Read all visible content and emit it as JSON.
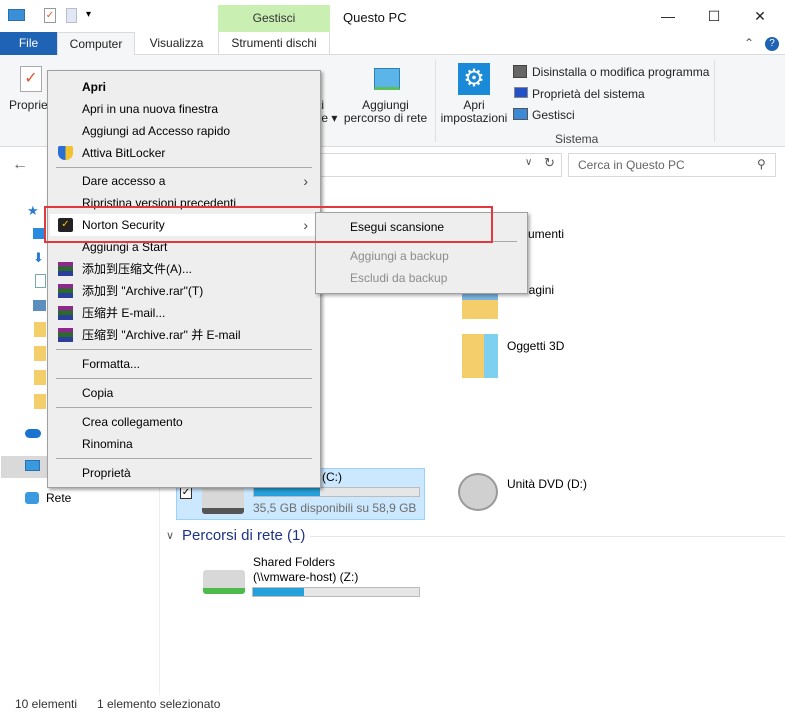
{
  "window": {
    "title": "Questo PC",
    "contextual_tab_group": "Gestisci",
    "minimize": "—",
    "maximize": "☐",
    "close": "✕"
  },
  "ribbon": {
    "tabs": [
      {
        "label": "File"
      },
      {
        "label": "Computer",
        "selected": true
      },
      {
        "label": "Visualizza"
      },
      {
        "label": "Strumenti dischi"
      }
    ],
    "buttons": {
      "properties": "Proprie",
      "map_drive_line1": "ti",
      "map_drive_line2": "te",
      "add_network_line1": "Aggiungi",
      "add_network_line2": "percorso di rete",
      "open_settings_line1": "Apri",
      "open_settings_line2": "impostazioni",
      "uninstall": "Disinstalla o modifica programma",
      "system_properties": "Proprietà del sistema",
      "manage": "Gestisci"
    },
    "group_system": "Sistema"
  },
  "addressbar": {
    "search_placeholder": "Cerca in Questo PC"
  },
  "sidebar": {
    "network": "Rete"
  },
  "content": {
    "folders": [
      {
        "name": "umenti"
      },
      {
        "name": "nagini"
      },
      {
        "name": "Oggetti 3D"
      }
    ],
    "drives": [
      {
        "name": "(C:)",
        "free": "35,5 GB disponibili su 58,9 GB",
        "used_percent": 40,
        "selected": true
      },
      {
        "name": "Unità DVD (D:)"
      }
    ],
    "network_header": "Percorsi di rete (1)",
    "network_locations": [
      {
        "name_line1": "Shared Folders",
        "name_line2": "(\\\\vmware-host) (Z:)",
        "used_percent": 31
      }
    ]
  },
  "context_menu": {
    "items": [
      "Apri",
      "Apri in una nuova finestra",
      "Aggiungi ad Accesso rapido",
      "Attiva BitLocker",
      "Dare accesso a",
      "Ripristina versioni precedenti",
      "Norton Security",
      "Aggiungi a Start",
      "添加到压缩文件(A)...",
      "添加到 \"Archive.rar\"(T)",
      "压缩并 E-mail...",
      "压缩到 \"Archive.rar\" 并 E-mail",
      "Formatta...",
      "Copia",
      "Crea collegamento",
      "Rinomina",
      "Proprietà"
    ]
  },
  "submenu": {
    "items": [
      {
        "label": "Esegui scansione",
        "enabled": true
      },
      {
        "label": "Aggiungi a backup",
        "enabled": false
      },
      {
        "label": "Escludi da backup",
        "enabled": false
      }
    ]
  },
  "statusbar": {
    "count": "10 elementi",
    "selection": "1 elemento selezionato"
  },
  "colors": {
    "accent": "#1e63b4",
    "highlight_box": "#e0393e",
    "progress": "#26a0da",
    "contextual_tab": "#c9efb3"
  }
}
